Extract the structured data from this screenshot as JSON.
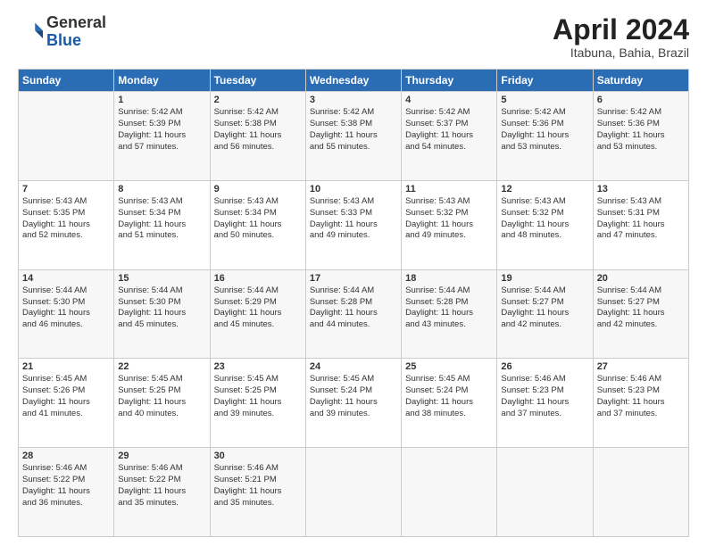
{
  "header": {
    "logo_general": "General",
    "logo_blue": "Blue",
    "month_title": "April 2024",
    "location": "Itabuna, Bahia, Brazil"
  },
  "days_of_week": [
    "Sunday",
    "Monday",
    "Tuesday",
    "Wednesday",
    "Thursday",
    "Friday",
    "Saturday"
  ],
  "weeks": [
    [
      {
        "day": "",
        "info": ""
      },
      {
        "day": "1",
        "info": "Sunrise: 5:42 AM\nSunset: 5:39 PM\nDaylight: 11 hours\nand 57 minutes."
      },
      {
        "day": "2",
        "info": "Sunrise: 5:42 AM\nSunset: 5:38 PM\nDaylight: 11 hours\nand 56 minutes."
      },
      {
        "day": "3",
        "info": "Sunrise: 5:42 AM\nSunset: 5:38 PM\nDaylight: 11 hours\nand 55 minutes."
      },
      {
        "day": "4",
        "info": "Sunrise: 5:42 AM\nSunset: 5:37 PM\nDaylight: 11 hours\nand 54 minutes."
      },
      {
        "day": "5",
        "info": "Sunrise: 5:42 AM\nSunset: 5:36 PM\nDaylight: 11 hours\nand 53 minutes."
      },
      {
        "day": "6",
        "info": "Sunrise: 5:42 AM\nSunset: 5:36 PM\nDaylight: 11 hours\nand 53 minutes."
      }
    ],
    [
      {
        "day": "7",
        "info": "Sunrise: 5:43 AM\nSunset: 5:35 PM\nDaylight: 11 hours\nand 52 minutes."
      },
      {
        "day": "8",
        "info": "Sunrise: 5:43 AM\nSunset: 5:34 PM\nDaylight: 11 hours\nand 51 minutes."
      },
      {
        "day": "9",
        "info": "Sunrise: 5:43 AM\nSunset: 5:34 PM\nDaylight: 11 hours\nand 50 minutes."
      },
      {
        "day": "10",
        "info": "Sunrise: 5:43 AM\nSunset: 5:33 PM\nDaylight: 11 hours\nand 49 minutes."
      },
      {
        "day": "11",
        "info": "Sunrise: 5:43 AM\nSunset: 5:32 PM\nDaylight: 11 hours\nand 49 minutes."
      },
      {
        "day": "12",
        "info": "Sunrise: 5:43 AM\nSunset: 5:32 PM\nDaylight: 11 hours\nand 48 minutes."
      },
      {
        "day": "13",
        "info": "Sunrise: 5:43 AM\nSunset: 5:31 PM\nDaylight: 11 hours\nand 47 minutes."
      }
    ],
    [
      {
        "day": "14",
        "info": "Sunrise: 5:44 AM\nSunset: 5:30 PM\nDaylight: 11 hours\nand 46 minutes."
      },
      {
        "day": "15",
        "info": "Sunrise: 5:44 AM\nSunset: 5:30 PM\nDaylight: 11 hours\nand 45 minutes."
      },
      {
        "day": "16",
        "info": "Sunrise: 5:44 AM\nSunset: 5:29 PM\nDaylight: 11 hours\nand 45 minutes."
      },
      {
        "day": "17",
        "info": "Sunrise: 5:44 AM\nSunset: 5:28 PM\nDaylight: 11 hours\nand 44 minutes."
      },
      {
        "day": "18",
        "info": "Sunrise: 5:44 AM\nSunset: 5:28 PM\nDaylight: 11 hours\nand 43 minutes."
      },
      {
        "day": "19",
        "info": "Sunrise: 5:44 AM\nSunset: 5:27 PM\nDaylight: 11 hours\nand 42 minutes."
      },
      {
        "day": "20",
        "info": "Sunrise: 5:44 AM\nSunset: 5:27 PM\nDaylight: 11 hours\nand 42 minutes."
      }
    ],
    [
      {
        "day": "21",
        "info": "Sunrise: 5:45 AM\nSunset: 5:26 PM\nDaylight: 11 hours\nand 41 minutes."
      },
      {
        "day": "22",
        "info": "Sunrise: 5:45 AM\nSunset: 5:25 PM\nDaylight: 11 hours\nand 40 minutes."
      },
      {
        "day": "23",
        "info": "Sunrise: 5:45 AM\nSunset: 5:25 PM\nDaylight: 11 hours\nand 39 minutes."
      },
      {
        "day": "24",
        "info": "Sunrise: 5:45 AM\nSunset: 5:24 PM\nDaylight: 11 hours\nand 39 minutes."
      },
      {
        "day": "25",
        "info": "Sunrise: 5:45 AM\nSunset: 5:24 PM\nDaylight: 11 hours\nand 38 minutes."
      },
      {
        "day": "26",
        "info": "Sunrise: 5:46 AM\nSunset: 5:23 PM\nDaylight: 11 hours\nand 37 minutes."
      },
      {
        "day": "27",
        "info": "Sunrise: 5:46 AM\nSunset: 5:23 PM\nDaylight: 11 hours\nand 37 minutes."
      }
    ],
    [
      {
        "day": "28",
        "info": "Sunrise: 5:46 AM\nSunset: 5:22 PM\nDaylight: 11 hours\nand 36 minutes."
      },
      {
        "day": "29",
        "info": "Sunrise: 5:46 AM\nSunset: 5:22 PM\nDaylight: 11 hours\nand 35 minutes."
      },
      {
        "day": "30",
        "info": "Sunrise: 5:46 AM\nSunset: 5:21 PM\nDaylight: 11 hours\nand 35 minutes."
      },
      {
        "day": "",
        "info": ""
      },
      {
        "day": "",
        "info": ""
      },
      {
        "day": "",
        "info": ""
      },
      {
        "day": "",
        "info": ""
      }
    ]
  ]
}
